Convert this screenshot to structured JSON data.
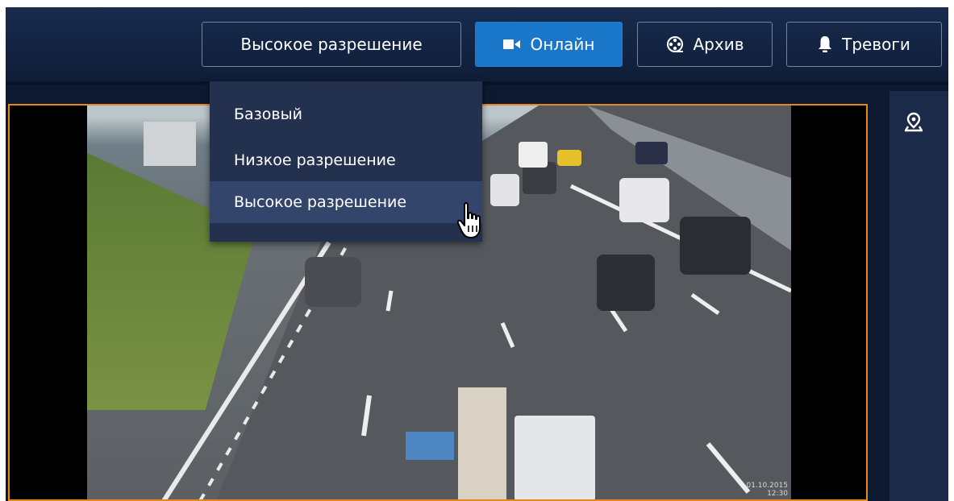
{
  "toolbar": {
    "quality_label": "Высокое разрешение",
    "online_label": "Онлайн",
    "archive_label": "Архив",
    "alarms_label": "Тревоги"
  },
  "quality_menu": {
    "items": [
      "Базовый",
      "Низкое разрешение",
      "Высокое разрешение"
    ],
    "hovered_index": 2
  },
  "video": {
    "timestamp_line1": "01.10.2015",
    "timestamp_line2": "12:30"
  },
  "icons": {
    "online": "video-camera-icon",
    "archive": "film-reel-icon",
    "alarms": "bell-icon",
    "sidebar": "map-pin-icon",
    "cursor": "hand-pointer-icon"
  },
  "colors": {
    "topbar": "#182b4e",
    "active_button": "#1976c9",
    "video_border": "#e9871c",
    "menu_bg": "#23314f",
    "menu_hover": "#34456b"
  }
}
